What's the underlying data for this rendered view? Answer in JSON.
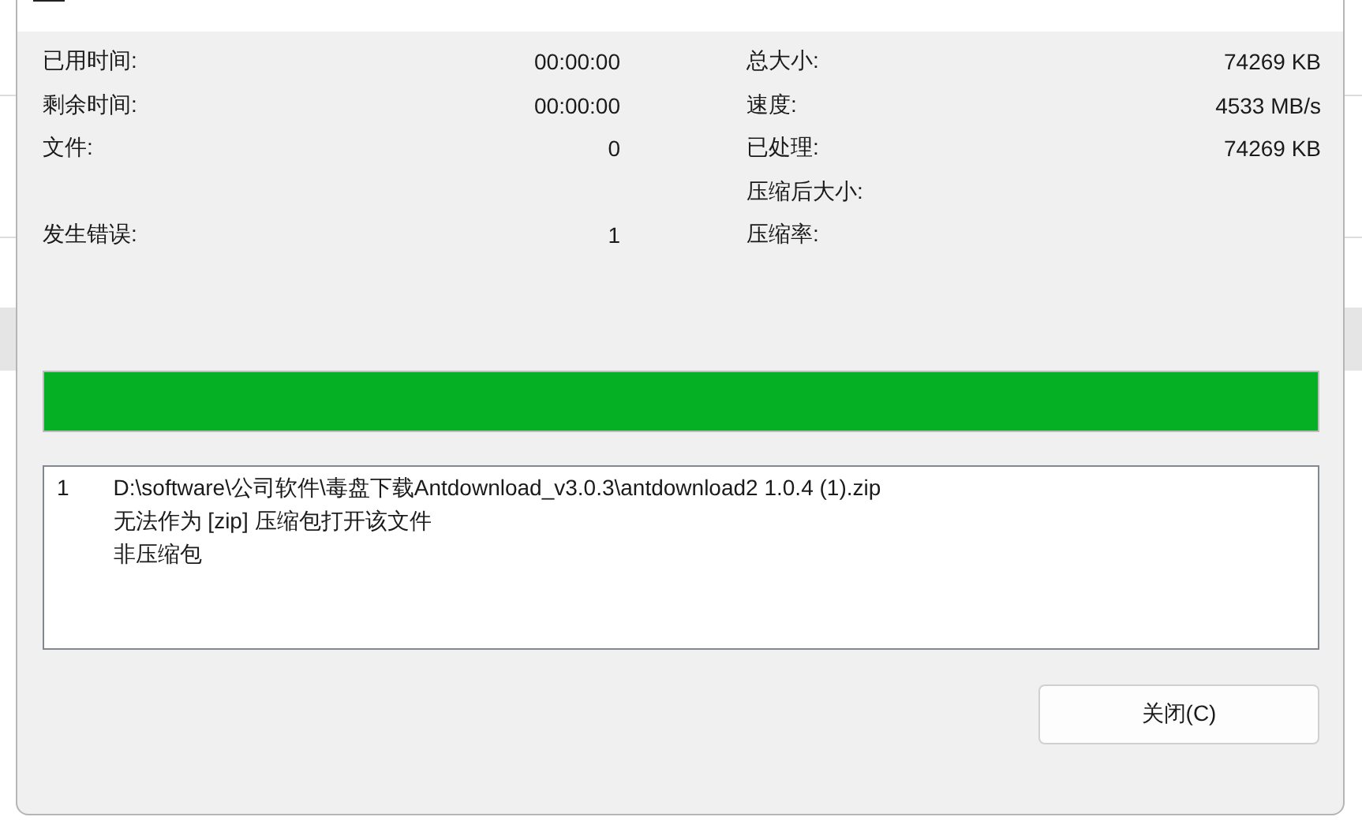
{
  "stats": [
    {
      "left": {
        "label": "已用时间:",
        "value": "00:00:00"
      },
      "right": {
        "label": "总大小:",
        "value": "74269 KB"
      }
    },
    {
      "left": {
        "label": "剩余时间:",
        "value": "00:00:00"
      },
      "right": {
        "label": "速度:",
        "value": "4533 MB/s"
      }
    },
    {
      "left": {
        "label": "文件:",
        "value": "0"
      },
      "right": {
        "label": "已处理:",
        "value": "74269 KB"
      }
    },
    {
      "right": {
        "label": "压缩后大小:"
      }
    },
    {
      "left": {
        "label": "发生错误:",
        "value": "1"
      },
      "right": {
        "label": "压缩率:"
      }
    }
  ],
  "progress": {
    "level": 1.0
  },
  "log": [
    {
      "number": "1",
      "lines": [
        "D:\\software\\公司软件\\毒盘下载Antdownload_v3.0.3\\antdownload2 1.0.4 (1).zip",
        "无法作为 [zip] 压缩包打开该文件",
        "非压缩包"
      ]
    }
  ],
  "buttons": [
    "关闭(C)"
  ]
}
